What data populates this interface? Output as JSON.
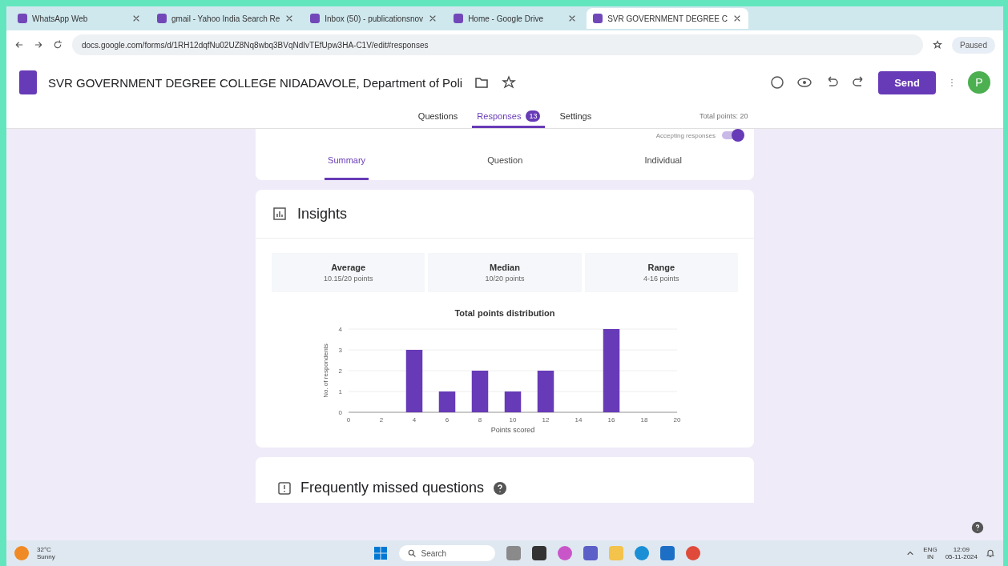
{
  "browser": {
    "tabs": [
      {
        "title": "WhatsApp Web",
        "selected": false
      },
      {
        "title": "gmail - Yahoo India Search Re",
        "selected": false
      },
      {
        "title": "Inbox (50) - publicationsnov",
        "selected": false
      },
      {
        "title": "Home - Google Drive",
        "selected": false
      },
      {
        "title": "SVR GOVERNMENT DEGREE C",
        "selected": true
      }
    ],
    "url": "docs.google.com/forms/d/1RH12dqfNu02UZ8Nq8wbq3BVqNdIvTEfUpw3HA-C1V/edit#responses",
    "profile": "Paused"
  },
  "form": {
    "title": "SVR GOVERNMENT DEGREE COLLEGE NIDADAVOLE, Department of Poli",
    "send": "Send",
    "avatar": "P",
    "tabs": [
      {
        "label": "Questions",
        "selected": false
      },
      {
        "label": "Responses",
        "selected": true,
        "badge": "13"
      },
      {
        "label": "Settings",
        "selected": false
      }
    ],
    "total_points": "Total points: 20"
  },
  "responses": {
    "accepting_label": "Accepting responses",
    "accepting": true,
    "views": [
      {
        "label": "Summary",
        "selected": true
      },
      {
        "label": "Question",
        "selected": false
      },
      {
        "label": "Individual",
        "selected": false
      }
    ]
  },
  "insights": {
    "title": "Insights",
    "stats": [
      {
        "label": "Average",
        "value": "10.15/20 points"
      },
      {
        "label": "Median",
        "value": "10/20 points"
      },
      {
        "label": "Range",
        "value": "4-16 points"
      }
    ],
    "chart_data": {
      "type": "bar",
      "title": "Total points distribution",
      "xlabel": "Points scored",
      "ylabel": "No. of respondents",
      "x": [
        4,
        6,
        8,
        10,
        12,
        16
      ],
      "series": [
        {
          "color": "#673ab7",
          "values": [
            3,
            1,
            2,
            1,
            2,
            4
          ]
        }
      ],
      "grid": true,
      "xlim": [
        0,
        20
      ],
      "ylim": [
        0,
        4
      ],
      "xticks": [
        0,
        2,
        4,
        6,
        8,
        10,
        12,
        14,
        16,
        18,
        20
      ],
      "yticks": [
        0,
        1,
        2,
        3,
        4
      ]
    }
  },
  "missed": {
    "title": "Frequently missed questions"
  },
  "taskbar": {
    "temperature": "32°C",
    "weather": "Sunny",
    "search": "Search",
    "lang": "ENG",
    "region": "IN",
    "time": "12:09",
    "date": "05-11-2024"
  }
}
